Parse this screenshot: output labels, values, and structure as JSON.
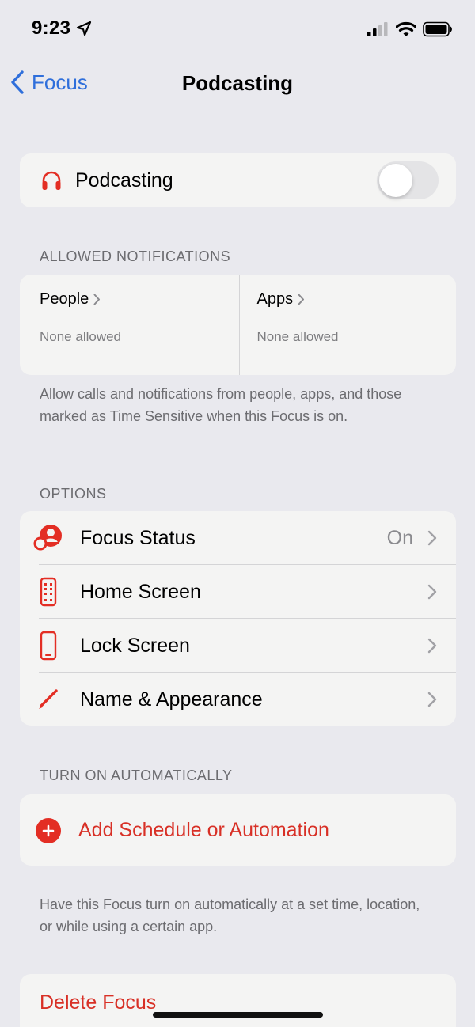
{
  "status_bar": {
    "time": "9:23"
  },
  "nav": {
    "back_label": "Focus",
    "title": "Podcasting"
  },
  "focus_toggle": {
    "label": "Podcasting",
    "enabled": false,
    "icon": "headphones-icon"
  },
  "allowed_notifications": {
    "header": "ALLOWED NOTIFICATIONS",
    "people": {
      "label": "People",
      "value": "None allowed"
    },
    "apps": {
      "label": "Apps",
      "value": "None allowed"
    },
    "footnote": "Allow calls and notifications from people, apps, and those marked as Time Sensitive when this Focus is on."
  },
  "options": {
    "header": "OPTIONS",
    "items": [
      {
        "label": "Focus Status",
        "value": "On",
        "icon": "focus-status-icon"
      },
      {
        "label": "Home Screen",
        "value": "",
        "icon": "home-screen-icon"
      },
      {
        "label": "Lock Screen",
        "value": "",
        "icon": "lock-screen-icon"
      },
      {
        "label": "Name & Appearance",
        "value": "",
        "icon": "pencil-icon"
      }
    ]
  },
  "turn_on_automatically": {
    "header": "TURN ON AUTOMATICALLY",
    "add_label": "Add Schedule or Automation",
    "footnote": "Have this Focus turn on automatically at a set time, location, or while using a certain app."
  },
  "delete": {
    "label": "Delete Focus"
  },
  "colors": {
    "accent_red": "#d83026",
    "link_blue": "#2f6fdb",
    "background": "#e9e9ee",
    "card": "#f4f4f3"
  }
}
